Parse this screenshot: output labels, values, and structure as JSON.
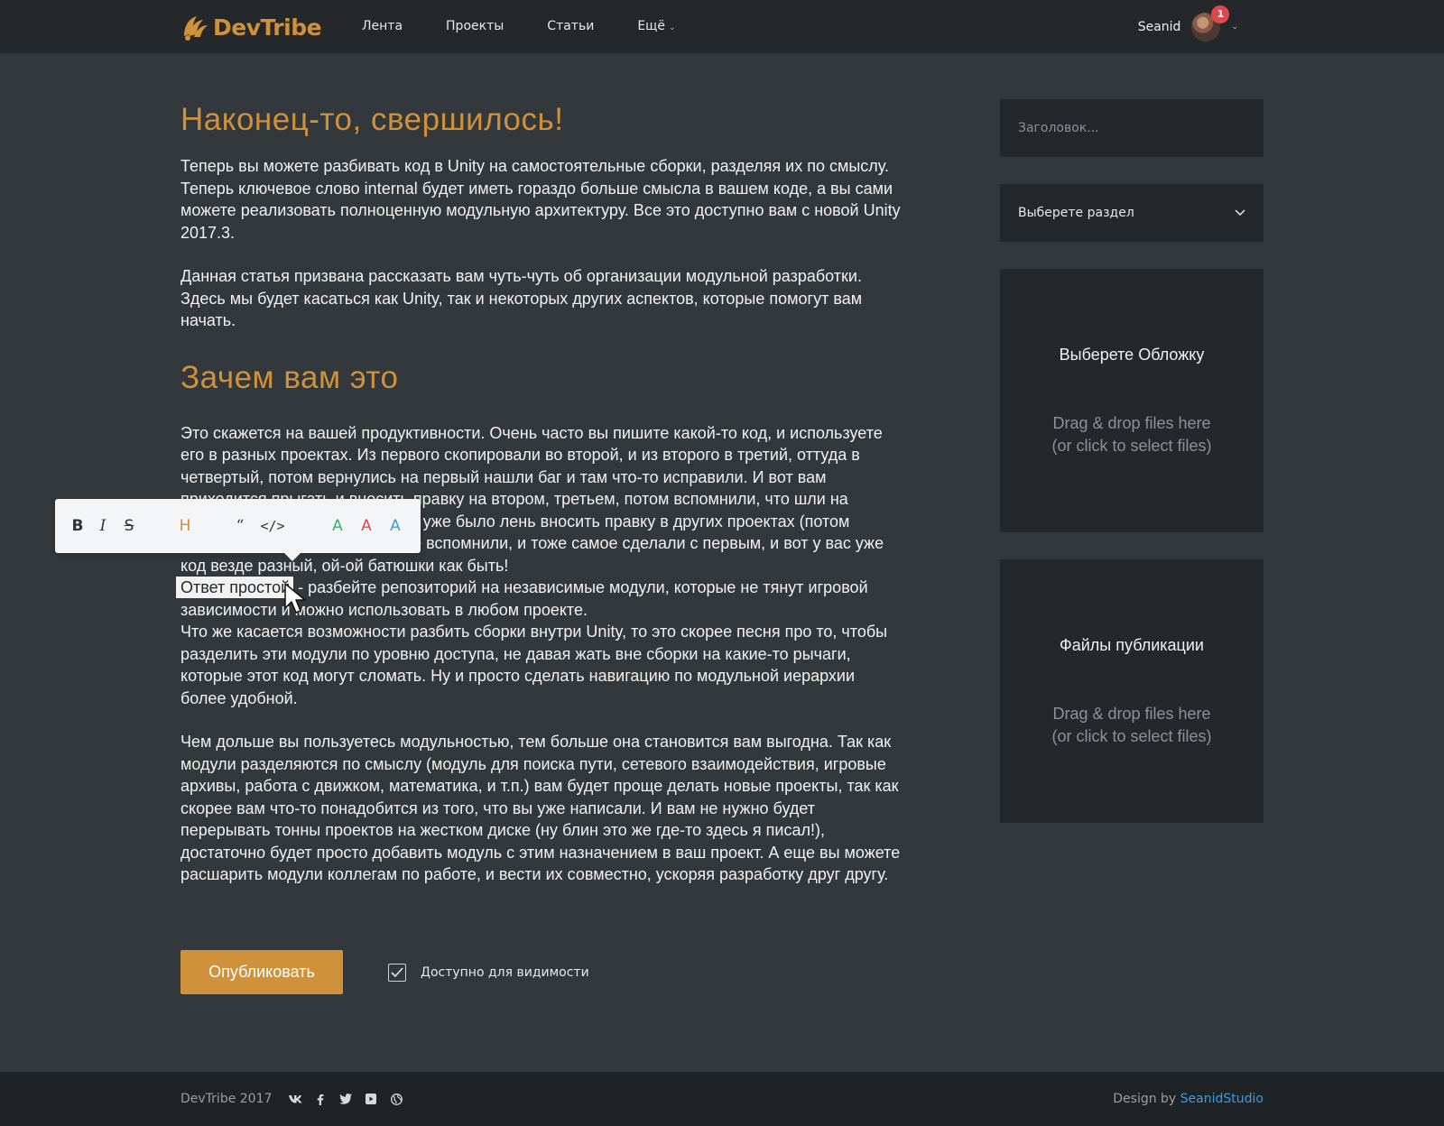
{
  "header": {
    "logo_text": "DevTribe",
    "nav": [
      {
        "label": "Лента"
      },
      {
        "label": "Проекты"
      },
      {
        "label": "Статьи"
      },
      {
        "label": "Ещё"
      }
    ],
    "user_name": "Seanid",
    "notification_count": "1"
  },
  "article": {
    "title": "Наконец-то, свершилось!",
    "p1": "Теперь вы можете разбивать код в Unity на самостоятельные сборки, разделяя их по смыслу. Теперь ключевое слово internal будет иметь гораздо больше смысла в вашем коде, а вы сами можете реализовать полноценную модульную архитектуру. Все это доступно вам с новой Unity 2017.3.",
    "p2": "Данная статья призвана рассказать вам чуть-чуть об организации модульной разработки. Здесь мы будет касаться как Unity, так и некоторых других аспектов, которые помогут вам начать.",
    "h2": "Зачем вам это",
    "p3": "Это скажется на вашей продуктивности. Очень часто вы пишите какой-то код, и используете его в разных проектах. Из первого скопировали во второй, и из второго в третий, оттуда в четвертый, потом вернулись на первый нашли баг и там что-то исправили. И вот вам приходится прыгать и вносить правку на втором, третьем, потом вспомнили, что шли на четвертый, что-то дописали, но уже было лень вносить правку в других проектах (потом вспомню). Потом вы конечно не вспомнили, и тоже самое сделали с первым, и вот у вас уже код везде разный, ой-ой батюшки как быть!",
    "p4_selected": "Ответ простой",
    "p4_rest": " - разбейте репозиторий на независимые модули, которые не тянут игровой зависимости и можно использовать в любом проекте.",
    "p5": "Что же касается возможности разбить сборки внутри Unity, то это скорее песня про то, чтобы разделить эти модули по уровню доступа, не давая жать вне сборки на какие-то рычаги, которые этот код могут сломать. Ну и просто сделать навигацию по модульной иерархии более удобной.",
    "p6": "Чем дольше вы пользуетесь модульностью, тем больше она становится вам выгодна. Так как модули разделяются по смыслу (модуль для поиска пути, сетевого взаимодействия, игровые архивы, работа с движком, математика, и т.п.) вам будет проще делать новые проекты, так как скорее вам что-то понадобится из того, что вы уже написали. И вам не нужно будет перерывать тонны проектов на жестком диске (ну блин это же где-то здесь я писал!), достаточно будет просто добавить модуль с этим назначением в ваш проект. А еще вы можете расшарить модули коллегам по работе, и вести их совместно, ускоряя разработку друг другу."
  },
  "toolbar": {
    "bold": "B",
    "italic": "I",
    "strike": "S",
    "heading": "H",
    "quote": "“",
    "code": "</>",
    "color_a": "A",
    "color_green": "#2fb36b",
    "color_red": "#e0474c",
    "color_blue": "#3e9be0"
  },
  "actions": {
    "publish_label": "Опубликовать",
    "visibility_label": "Доступно для видимости",
    "visibility_checked": true
  },
  "sidebar": {
    "title_placeholder": "Заголовок...",
    "section_placeholder": "Выберете раздел",
    "cover_title": "Выберете Обложку",
    "cover_hint_1": "Drag & drop files here",
    "cover_hint_2": "(or click to select files)",
    "files_title": "Файлы публикации",
    "files_hint_1": "Drag & drop files here",
    "files_hint_2": "(or click to select files)"
  },
  "footer": {
    "copyright": "DevTribe 2017",
    "socials": [
      "vk-icon",
      "facebook-icon",
      "twitter-icon",
      "youtube-icon",
      "globe-icon"
    ],
    "credit_prefix": "Design by ",
    "credit_link": "SeanidStudio"
  },
  "colors": {
    "accent": "#cf913a",
    "background": "#33383c",
    "panel": "#25282b",
    "link": "#3e9be0"
  }
}
